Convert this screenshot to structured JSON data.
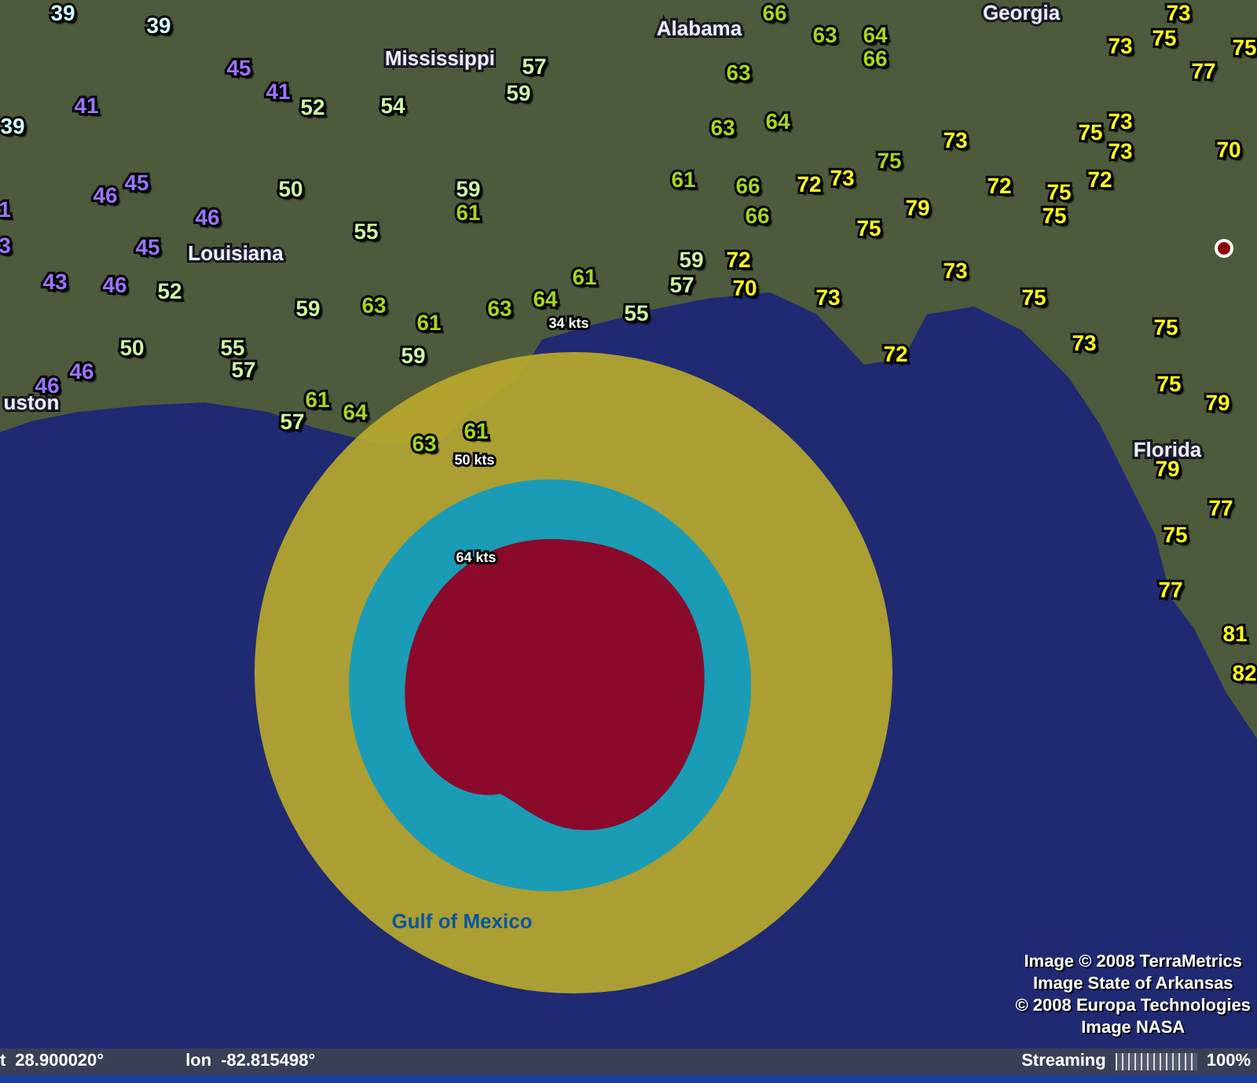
{
  "map": {
    "readings": [
      {
        "value": "39",
        "color": "#d0ffff"
      },
      {
        "value": "39",
        "color": "#d0ffff"
      },
      {
        "value": "39",
        "color": "#d0ffff"
      },
      {
        "value": "41",
        "color": "#9b74ff"
      },
      {
        "value": "45",
        "color": "#9b74ff"
      },
      {
        "value": "41",
        "color": "#9b74ff"
      },
      {
        "value": "52",
        "color": "#ccf7a0"
      },
      {
        "value": "54",
        "color": "#ccf7a0"
      },
      {
        "value": "57",
        "color": "#ccf7a0"
      },
      {
        "value": "59",
        "color": "#ccf7a0"
      },
      {
        "value": "1",
        "color": "#9b74ff"
      },
      {
        "value": "45",
        "color": "#9b74ff"
      },
      {
        "value": "46",
        "color": "#9b74ff"
      },
      {
        "value": "50",
        "color": "#ccf7a0"
      },
      {
        "value": "46",
        "color": "#9b74ff"
      },
      {
        "value": "59",
        "color": "#ccf7a0"
      },
      {
        "value": "61",
        "color": "#a8d61c"
      },
      {
        "value": "55",
        "color": "#ccf7a0"
      },
      {
        "value": "3",
        "color": "#9b74ff"
      },
      {
        "value": "45",
        "color": "#9b74ff"
      },
      {
        "value": "43",
        "color": "#9b74ff"
      },
      {
        "value": "46",
        "color": "#9b74ff"
      },
      {
        "value": "52",
        "color": "#ccf7a0"
      },
      {
        "value": "59",
        "color": "#ccf7a0"
      },
      {
        "value": "63",
        "color": "#a8d61c"
      },
      {
        "value": "61",
        "color": "#a8d61c"
      },
      {
        "value": "63",
        "color": "#a8d61c"
      },
      {
        "value": "64",
        "color": "#a8d61c"
      },
      {
        "value": "61",
        "color": "#a8d61c"
      },
      {
        "value": "50",
        "color": "#ccf7a0"
      },
      {
        "value": "46",
        "color": "#9b74ff"
      },
      {
        "value": "46",
        "color": "#9b74ff"
      },
      {
        "value": "55",
        "color": "#ccf7a0"
      },
      {
        "value": "57",
        "color": "#ccf7a0"
      },
      {
        "value": "59",
        "color": "#ccf7a0"
      },
      {
        "value": "61",
        "color": "#a8d61c"
      },
      {
        "value": "57",
        "color": "#ccf7a0"
      },
      {
        "value": "64",
        "color": "#a8d61c"
      },
      {
        "value": "63",
        "color": "#a8d61c"
      },
      {
        "value": "61",
        "color": "#a8d61c"
      },
      {
        "value": "66",
        "color": "#a8d61c"
      },
      {
        "value": "63",
        "color": "#a8d61c"
      },
      {
        "value": "64",
        "color": "#a8d61c"
      },
      {
        "value": "66",
        "color": "#a8d61c"
      },
      {
        "value": "63",
        "color": "#a8d61c"
      },
      {
        "value": "63",
        "color": "#a8d61c"
      },
      {
        "value": "64",
        "color": "#a8d61c"
      },
      {
        "value": "61",
        "color": "#a8d61c"
      },
      {
        "value": "66",
        "color": "#a8d61c"
      },
      {
        "value": "72",
        "color": "#ffff1a"
      },
      {
        "value": "73",
        "color": "#ffff1a"
      },
      {
        "value": "75",
        "color": "#a8d61c"
      },
      {
        "value": "66",
        "color": "#a8d61c"
      },
      {
        "value": "79",
        "color": "#ffff1a"
      },
      {
        "value": "75",
        "color": "#ffff1a"
      },
      {
        "value": "59",
        "color": "#ccf7a0"
      },
      {
        "value": "72",
        "color": "#ffff1a"
      },
      {
        "value": "57",
        "color": "#ccf7a0"
      },
      {
        "value": "70",
        "color": "#ffff1a"
      },
      {
        "value": "55",
        "color": "#ccf7a0"
      },
      {
        "value": "73",
        "color": "#ffff1a"
      },
      {
        "value": "72",
        "color": "#ffff1a"
      },
      {
        "value": "73",
        "color": "#ffff1a"
      },
      {
        "value": "73",
        "color": "#ffff1a"
      },
      {
        "value": "75",
        "color": "#ffff1a"
      },
      {
        "value": "75",
        "color": "#ffff1a"
      },
      {
        "value": "77",
        "color": "#ffff1a"
      },
      {
        "value": "73",
        "color": "#ffff1a"
      },
      {
        "value": "72",
        "color": "#ffff1a"
      },
      {
        "value": "75",
        "color": "#ffff1a"
      },
      {
        "value": "73",
        "color": "#ffff1a"
      },
      {
        "value": "73",
        "color": "#ffff1a"
      },
      {
        "value": "72",
        "color": "#ffff1a"
      },
      {
        "value": "75",
        "color": "#ffff1a"
      },
      {
        "value": "75",
        "color": "#ffff1a"
      },
      {
        "value": "70",
        "color": "#ffff1a"
      },
      {
        "value": "73",
        "color": "#ffff1a"
      },
      {
        "value": "75",
        "color": "#ffff1a"
      },
      {
        "value": "73",
        "color": "#ffff1a"
      },
      {
        "value": "75",
        "color": "#ffff1a"
      },
      {
        "value": "75",
        "color": "#ffff1a"
      },
      {
        "value": "79",
        "color": "#ffff1a"
      },
      {
        "value": "79",
        "color": "#ffff1a"
      },
      {
        "value": "77",
        "color": "#ffff1a"
      },
      {
        "value": "75",
        "color": "#ffff1a"
      },
      {
        "value": "77",
        "color": "#ffff1a"
      },
      {
        "value": "81",
        "color": "#ffff1a"
      },
      {
        "value": "82",
        "color": "#ffff1a"
      }
    ],
    "places": [
      "Alabama",
      "Georgia",
      "Mississippi",
      "Louisiana",
      "uston",
      "Florida"
    ],
    "wind_radii": [
      "34 kts",
      "50 kts",
      "64 kts"
    ],
    "water_label": "Gulf of Mexico",
    "attribution": [
      "Image © 2008 TerraMetrics",
      "Image State of Arkansas",
      "© 2008 Europa Technologies",
      "Image NASA"
    ]
  },
  "status_bar": {
    "lat_label": "t",
    "lat_value": "28.900020°",
    "lon_label": "lon",
    "lon_value": "-82.815498°",
    "streaming_label": "Streaming",
    "streaming": {
      "level": 1
    },
    "streaming_percent": "100%"
  }
}
